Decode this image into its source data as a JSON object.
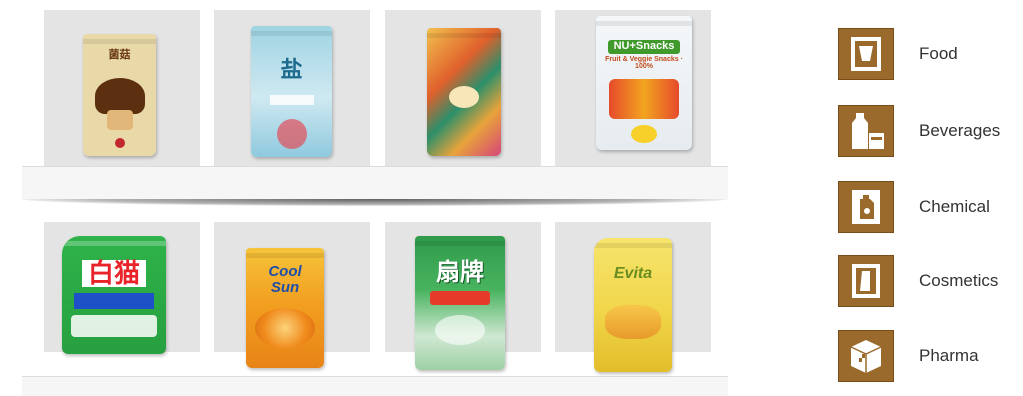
{
  "shelves": {
    "top": [
      {
        "name": "mushroom-stand-up-pouch",
        "brand": "菌菇",
        "sub": "",
        "bg": "#e9d9a8",
        "accent": "#6b3a12"
      },
      {
        "name": "sea-salt-pouch",
        "brand": "盐",
        "sub": "",
        "bg": "#bfe0ea",
        "accent": "#1d6b8e"
      },
      {
        "name": "tropical-print-pouch",
        "brand": "",
        "sub": "",
        "bg": "#e8a33a",
        "accent": "#c64a2c"
      },
      {
        "name": "nu-snacks-pouch",
        "brand": "NU+Snacks",
        "sub": "Fruit & Veggie Snacks · 100%",
        "bg": "#eef3f6",
        "accent": "#3f9a2b"
      }
    ],
    "bottom": [
      {
        "name": "detergent-spout-pouch",
        "brand": "白猫",
        "sub": "",
        "bg": "#2fa83a",
        "accent": "#1541b8"
      },
      {
        "name": "cool-sun-orange-pouch",
        "brand": "Cool Sun",
        "sub": "",
        "bg": "#f2a020",
        "accent": "#1f4fa8"
      },
      {
        "name": "dishwash-pouch",
        "brand": "扇牌",
        "sub": "",
        "bg": "#2f9a4a",
        "accent": "#ffffff"
      },
      {
        "name": "yellow-spout-pouch",
        "brand": "Evita",
        "sub": "",
        "bg": "#f1d64a",
        "accent": "#6a8d1f"
      }
    ]
  },
  "legend": {
    "items": [
      {
        "label": "Food",
        "icon": "food-pouch-icon"
      },
      {
        "label": "Beverages",
        "icon": "beverage-bottle-icon"
      },
      {
        "label": "Chemical",
        "icon": "chemical-spray-icon"
      },
      {
        "label": "Cosmetics",
        "icon": "cosmetics-icon"
      },
      {
        "label": "Pharma",
        "icon": "pharma-box-icon"
      }
    ]
  },
  "colors": {
    "icon_bg": "#9a6a2c",
    "shelf": "#f6f6f6",
    "bay": "#e4e4e4"
  }
}
